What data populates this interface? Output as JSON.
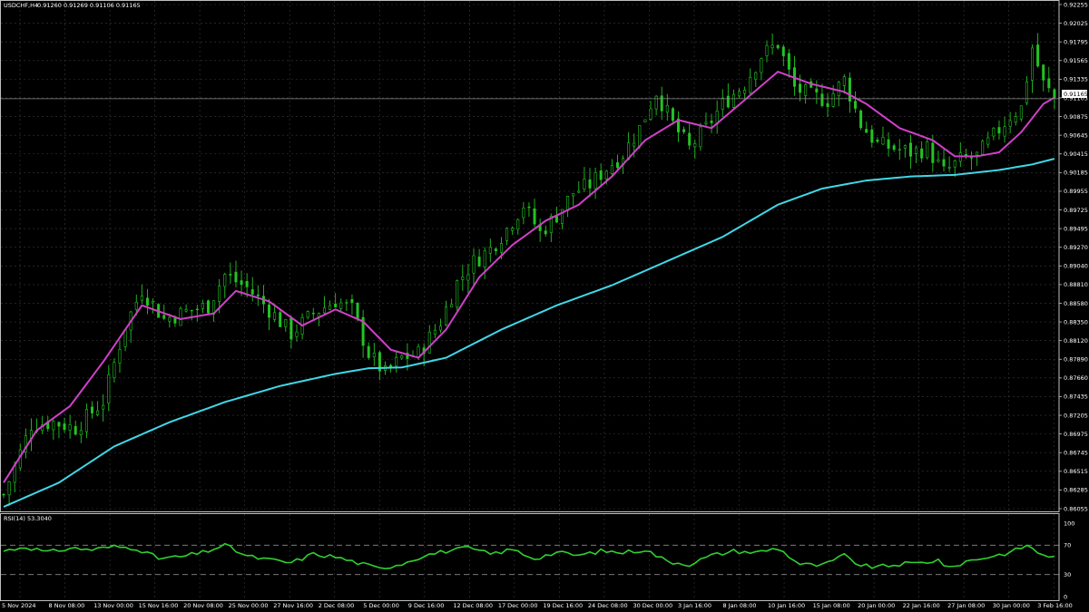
{
  "header": {
    "symbol_label": "USDCHF,H4",
    "ohlc_label": "0.91260 0.91269 0.91106 0.91165"
  },
  "current_price_label": "0.91165",
  "colors": {
    "background": "#000000",
    "grid": "#3a3a3a",
    "candle": "#22c422",
    "ma_fast": "#d040c8",
    "ma_slow": "#40d8e8",
    "rsi_line": "#30d030",
    "axis_text": "#ffffff",
    "level_dash": "#8a8a8a"
  },
  "chart_data": [
    {
      "type": "line",
      "title": "USDCHF,H4",
      "subtitle": "0.91260 0.91269 0.91106 0.91165",
      "y_tick_labels": [
        "0.92255",
        "0.92025",
        "0.91795",
        "0.91565",
        "0.91335",
        "0.91105",
        "0.90875",
        "0.90645",
        "0.90415",
        "0.90185",
        "0.89955",
        "0.89725",
        "0.89495",
        "0.89270",
        "0.89040",
        "0.88810",
        "0.88580",
        "0.88350",
        "0.88120",
        "0.87890",
        "0.87660",
        "0.87435",
        "0.87205",
        "0.86975",
        "0.86745",
        "0.86515",
        "0.86285",
        "0.86055"
      ],
      "x_tick_labels": [
        "5 Nov 2024",
        "8 Nov 08:00",
        "13 Nov 00:00",
        "15 Nov 16:00",
        "20 Nov 08:00",
        "25 Nov 00:00",
        "27 Nov 16:00",
        "2 Dec 08:00",
        "5 Dec 00:00",
        "9 Dec 16:00",
        "12 Dec 08:00",
        "17 Dec 00:00",
        "19 Dec 16:00",
        "24 Dec 08:00",
        "30 Dec 00:00",
        "3 Jan 16:00",
        "8 Jan 08:00",
        "10 Jan 16:00",
        "15 Jan 08:00",
        "20 Jan 00:00",
        "22 Jan 16:00",
        "27 Jan 08:00",
        "30 Jan 00:00",
        "3 Feb 16:00"
      ],
      "ylim": [
        0.86055,
        0.92255
      ],
      "grid": true,
      "current_price": 0.91165,
      "price_keypoints": [
        {
          "x": 0,
          "y": 0.8625
        },
        {
          "x": 5,
          "y": 0.8712
        },
        {
          "x": 9,
          "y": 0.8715
        },
        {
          "x": 13,
          "y": 0.8708
        },
        {
          "x": 18,
          "y": 0.8741
        },
        {
          "x": 22,
          "y": 0.8835
        },
        {
          "x": 25,
          "y": 0.888
        },
        {
          "x": 29,
          "y": 0.8843
        },
        {
          "x": 33,
          "y": 0.8852
        },
        {
          "x": 37,
          "y": 0.886
        },
        {
          "x": 40,
          "y": 0.8898
        },
        {
          "x": 44,
          "y": 0.8882
        },
        {
          "x": 48,
          "y": 0.8855
        },
        {
          "x": 52,
          "y": 0.8825
        },
        {
          "x": 56,
          "y": 0.885
        },
        {
          "x": 60,
          "y": 0.8866
        },
        {
          "x": 63,
          "y": 0.8855
        },
        {
          "x": 66,
          "y": 0.88
        },
        {
          "x": 69,
          "y": 0.8775
        },
        {
          "x": 72,
          "y": 0.8795
        },
        {
          "x": 75,
          "y": 0.88
        },
        {
          "x": 79,
          "y": 0.884
        },
        {
          "x": 82,
          "y": 0.8888
        },
        {
          "x": 85,
          "y": 0.8914
        },
        {
          "x": 88,
          "y": 0.893
        },
        {
          "x": 91,
          "y": 0.8955
        },
        {
          "x": 94,
          "y": 0.8985
        },
        {
          "x": 97,
          "y": 0.895
        },
        {
          "x": 100,
          "y": 0.8972
        },
        {
          "x": 103,
          "y": 0.9
        },
        {
          "x": 106,
          "y": 0.901
        },
        {
          "x": 109,
          "y": 0.903
        },
        {
          "x": 112,
          "y": 0.9048
        },
        {
          "x": 115,
          "y": 0.908
        },
        {
          "x": 118,
          "y": 0.9125
        },
        {
          "x": 121,
          "y": 0.9085
        },
        {
          "x": 124,
          "y": 0.9055
        },
        {
          "x": 127,
          "y": 0.908
        },
        {
          "x": 130,
          "y": 0.911
        },
        {
          "x": 134,
          "y": 0.9135
        },
        {
          "x": 137,
          "y": 0.917
        },
        {
          "x": 140,
          "y": 0.9185
        },
        {
          "x": 143,
          "y": 0.913
        },
        {
          "x": 146,
          "y": 0.912
        },
        {
          "x": 149,
          "y": 0.9115
        },
        {
          "x": 152,
          "y": 0.914
        },
        {
          "x": 155,
          "y": 0.9085
        },
        {
          "x": 158,
          "y": 0.906
        },
        {
          "x": 161,
          "y": 0.9055
        },
        {
          "x": 164,
          "y": 0.905
        },
        {
          "x": 167,
          "y": 0.9055
        },
        {
          "x": 170,
          "y": 0.9025
        },
        {
          "x": 173,
          "y": 0.904
        },
        {
          "x": 176,
          "y": 0.9045
        },
        {
          "x": 179,
          "y": 0.907
        },
        {
          "x": 182,
          "y": 0.9095
        },
        {
          "x": 184,
          "y": 0.9105
        },
        {
          "x": 186,
          "y": 0.918
        },
        {
          "x": 188,
          "y": 0.9135
        },
        {
          "x": 190,
          "y": 0.9117
        }
      ],
      "ma_fast_keypoints": [
        {
          "x": 0,
          "y": 0.864
        },
        {
          "x": 6,
          "y": 0.8705
        },
        {
          "x": 12,
          "y": 0.8735
        },
        {
          "x": 18,
          "y": 0.879
        },
        {
          "x": 25,
          "y": 0.886
        },
        {
          "x": 32,
          "y": 0.8843
        },
        {
          "x": 38,
          "y": 0.885
        },
        {
          "x": 42,
          "y": 0.8878
        },
        {
          "x": 48,
          "y": 0.8865
        },
        {
          "x": 54,
          "y": 0.8835
        },
        {
          "x": 60,
          "y": 0.8855
        },
        {
          "x": 65,
          "y": 0.884
        },
        {
          "x": 70,
          "y": 0.8805
        },
        {
          "x": 75,
          "y": 0.8795
        },
        {
          "x": 80,
          "y": 0.883
        },
        {
          "x": 86,
          "y": 0.8895
        },
        {
          "x": 92,
          "y": 0.8935
        },
        {
          "x": 98,
          "y": 0.8965
        },
        {
          "x": 104,
          "y": 0.8985
        },
        {
          "x": 110,
          "y": 0.902
        },
        {
          "x": 116,
          "y": 0.9065
        },
        {
          "x": 122,
          "y": 0.909
        },
        {
          "x": 128,
          "y": 0.908
        },
        {
          "x": 134,
          "y": 0.9115
        },
        {
          "x": 140,
          "y": 0.915
        },
        {
          "x": 146,
          "y": 0.9135
        },
        {
          "x": 152,
          "y": 0.9125
        },
        {
          "x": 156,
          "y": 0.911
        },
        {
          "x": 162,
          "y": 0.908
        },
        {
          "x": 168,
          "y": 0.9065
        },
        {
          "x": 172,
          "y": 0.9045
        },
        {
          "x": 176,
          "y": 0.9045
        },
        {
          "x": 180,
          "y": 0.905
        },
        {
          "x": 184,
          "y": 0.9075
        },
        {
          "x": 188,
          "y": 0.911
        },
        {
          "x": 190,
          "y": 0.9118
        }
      ],
      "ma_slow_keypoints": [
        {
          "x": 0,
          "y": 0.861
        },
        {
          "x": 10,
          "y": 0.864
        },
        {
          "x": 20,
          "y": 0.8685
        },
        {
          "x": 30,
          "y": 0.8715
        },
        {
          "x": 40,
          "y": 0.874
        },
        {
          "x": 50,
          "y": 0.876
        },
        {
          "x": 60,
          "y": 0.8775
        },
        {
          "x": 66,
          "y": 0.8782
        },
        {
          "x": 72,
          "y": 0.8783
        },
        {
          "x": 80,
          "y": 0.8795
        },
        {
          "x": 90,
          "y": 0.883
        },
        {
          "x": 100,
          "y": 0.886
        },
        {
          "x": 110,
          "y": 0.8885
        },
        {
          "x": 120,
          "y": 0.8915
        },
        {
          "x": 130,
          "y": 0.8945
        },
        {
          "x": 140,
          "y": 0.8985
        },
        {
          "x": 148,
          "y": 0.9005
        },
        {
          "x": 156,
          "y": 0.9015
        },
        {
          "x": 164,
          "y": 0.902
        },
        {
          "x": 172,
          "y": 0.9022
        },
        {
          "x": 180,
          "y": 0.9028
        },
        {
          "x": 186,
          "y": 0.9035
        },
        {
          "x": 190,
          "y": 0.9042
        }
      ],
      "n_bars": 191
    },
    {
      "type": "line",
      "title": "RSI(14) 53.3040",
      "ylim": [
        0,
        100
      ],
      "y_tick_labels": [
        "100",
        "70",
        "30",
        "0"
      ],
      "levels": [
        70,
        30
      ],
      "rsi_keypoints": [
        {
          "x": 0,
          "y": 62
        },
        {
          "x": 4,
          "y": 68
        },
        {
          "x": 8,
          "y": 60
        },
        {
          "x": 12,
          "y": 66
        },
        {
          "x": 16,
          "y": 64
        },
        {
          "x": 20,
          "y": 68
        },
        {
          "x": 24,
          "y": 66
        },
        {
          "x": 28,
          "y": 52
        },
        {
          "x": 32,
          "y": 54
        },
        {
          "x": 36,
          "y": 60
        },
        {
          "x": 40,
          "y": 70
        },
        {
          "x": 44,
          "y": 55
        },
        {
          "x": 48,
          "y": 50
        },
        {
          "x": 52,
          "y": 46
        },
        {
          "x": 56,
          "y": 58
        },
        {
          "x": 60,
          "y": 54
        },
        {
          "x": 64,
          "y": 46
        },
        {
          "x": 68,
          "y": 38
        },
        {
          "x": 72,
          "y": 45
        },
        {
          "x": 76,
          "y": 56
        },
        {
          "x": 80,
          "y": 62
        },
        {
          "x": 84,
          "y": 66
        },
        {
          "x": 88,
          "y": 58
        },
        {
          "x": 92,
          "y": 64
        },
        {
          "x": 96,
          "y": 52
        },
        {
          "x": 100,
          "y": 60
        },
        {
          "x": 104,
          "y": 56
        },
        {
          "x": 108,
          "y": 62
        },
        {
          "x": 112,
          "y": 60
        },
        {
          "x": 116,
          "y": 64
        },
        {
          "x": 120,
          "y": 48
        },
        {
          "x": 124,
          "y": 44
        },
        {
          "x": 128,
          "y": 56
        },
        {
          "x": 132,
          "y": 62
        },
        {
          "x": 136,
          "y": 60
        },
        {
          "x": 140,
          "y": 66
        },
        {
          "x": 144,
          "y": 44
        },
        {
          "x": 148,
          "y": 42
        },
        {
          "x": 152,
          "y": 56
        },
        {
          "x": 155,
          "y": 42
        },
        {
          "x": 158,
          "y": 40
        },
        {
          "x": 162,
          "y": 44
        },
        {
          "x": 166,
          "y": 46
        },
        {
          "x": 169,
          "y": 50
        },
        {
          "x": 171,
          "y": 38
        },
        {
          "x": 174,
          "y": 48
        },
        {
          "x": 178,
          "y": 54
        },
        {
          "x": 182,
          "y": 60
        },
        {
          "x": 185,
          "y": 70
        },
        {
          "x": 187,
          "y": 60
        },
        {
          "x": 190,
          "y": 53
        }
      ]
    }
  ]
}
